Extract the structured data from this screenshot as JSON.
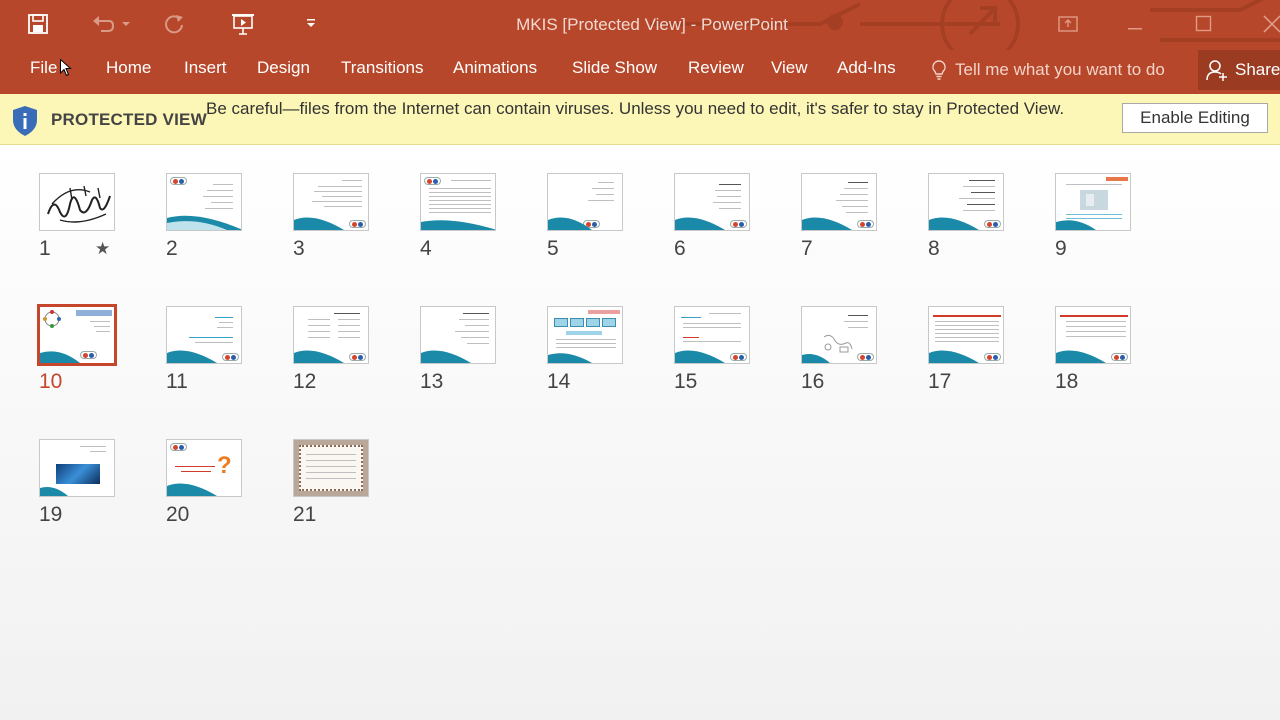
{
  "window": {
    "title": "MKIS [Protected View] - PowerPoint"
  },
  "ribbon": {
    "tabs": [
      "File",
      "Home",
      "Insert",
      "Design",
      "Transitions",
      "Animations",
      "Slide Show",
      "Review",
      "View",
      "Add-Ins"
    ],
    "tell_me": "Tell me what you want to do",
    "share": "Share"
  },
  "protected_view": {
    "title": "PROTECTED VIEW",
    "message": "Be careful—files from the Internet can contain viruses. Unless you need to edit, it's safer to stay in Protected View.",
    "enable_button": "Enable Editing"
  },
  "slides": [
    {
      "number": "1",
      "content": "calligraphy"
    },
    {
      "number": "2",
      "content": "text"
    },
    {
      "number": "3",
      "content": "text"
    },
    {
      "number": "4",
      "content": "text-dense"
    },
    {
      "number": "5",
      "content": "text"
    },
    {
      "number": "6",
      "content": "bullets"
    },
    {
      "number": "7",
      "content": "bullets"
    },
    {
      "number": "8",
      "content": "bullets"
    },
    {
      "number": "9",
      "content": "image"
    },
    {
      "number": "10",
      "content": "diagram"
    },
    {
      "number": "11",
      "content": "text"
    },
    {
      "number": "12",
      "content": "text"
    },
    {
      "number": "13",
      "content": "text"
    },
    {
      "number": "14",
      "content": "boxes"
    },
    {
      "number": "15",
      "content": "text"
    },
    {
      "number": "16",
      "content": "sketch"
    },
    {
      "number": "17",
      "content": "red-header"
    },
    {
      "number": "18",
      "content": "red-header"
    },
    {
      "number": "19",
      "content": "photo"
    },
    {
      "number": "20",
      "content": "question"
    },
    {
      "number": "21",
      "content": "framed"
    }
  ],
  "selected_slide": "10",
  "animated_slide": "1",
  "colors": {
    "accent": "#b7472a",
    "protected_bar": "#fcf7b6",
    "selection": "#c5462a"
  }
}
